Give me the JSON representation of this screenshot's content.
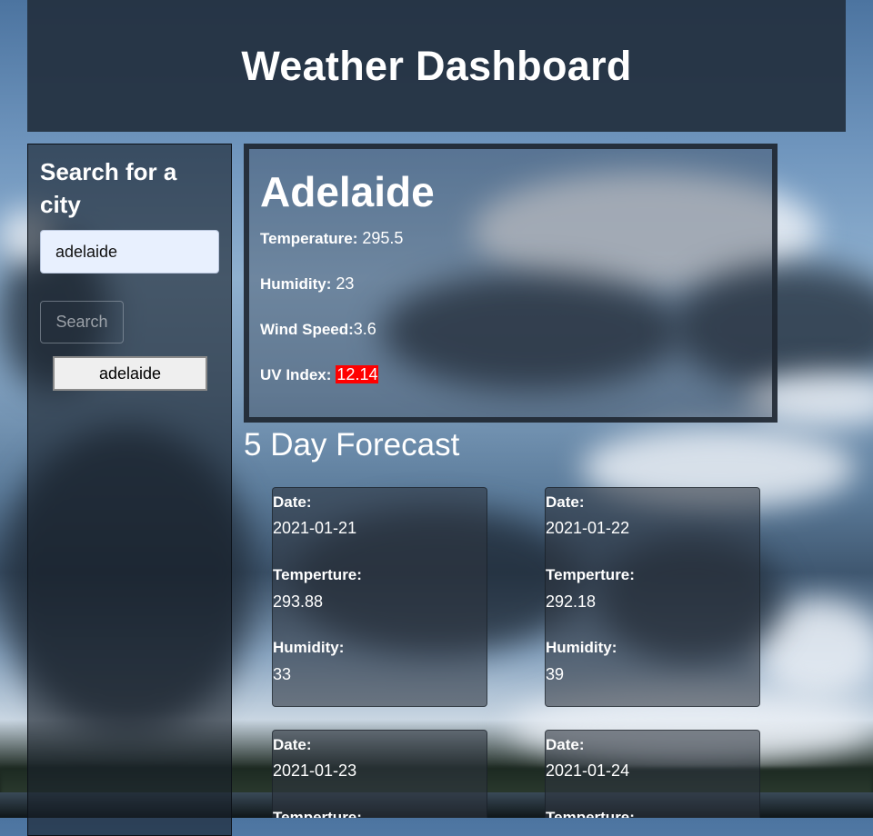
{
  "header": {
    "title": "Weather Dashboard"
  },
  "sidebar": {
    "heading": "Search for a city",
    "search_value": "adelaide",
    "search_button": "Search",
    "history": [
      "adelaide"
    ]
  },
  "current": {
    "city": "Adelaide",
    "temperature_label": "Temperature:",
    "temperature_value": " 295.5",
    "humidity_label": "Humidity:",
    "humidity_value": " 23",
    "wind_label": "Wind Speed:",
    "wind_value": "3.6",
    "uv_label": "UV Index:",
    "uv_value": "12.14",
    "uv_color": "#ff0000"
  },
  "forecast": {
    "title": "5 Day Forecast",
    "date_label": "Date:",
    "temp_label": "Temperture:",
    "humidity_label": "Humidity:",
    "days": [
      {
        "date": "2021-01-21",
        "temp": "293.88",
        "humidity": "33"
      },
      {
        "date": "2021-01-22",
        "temp": "292.18",
        "humidity": "39"
      },
      {
        "date": "2021-01-23"
      },
      {
        "date": "2021-01-24"
      }
    ]
  }
}
